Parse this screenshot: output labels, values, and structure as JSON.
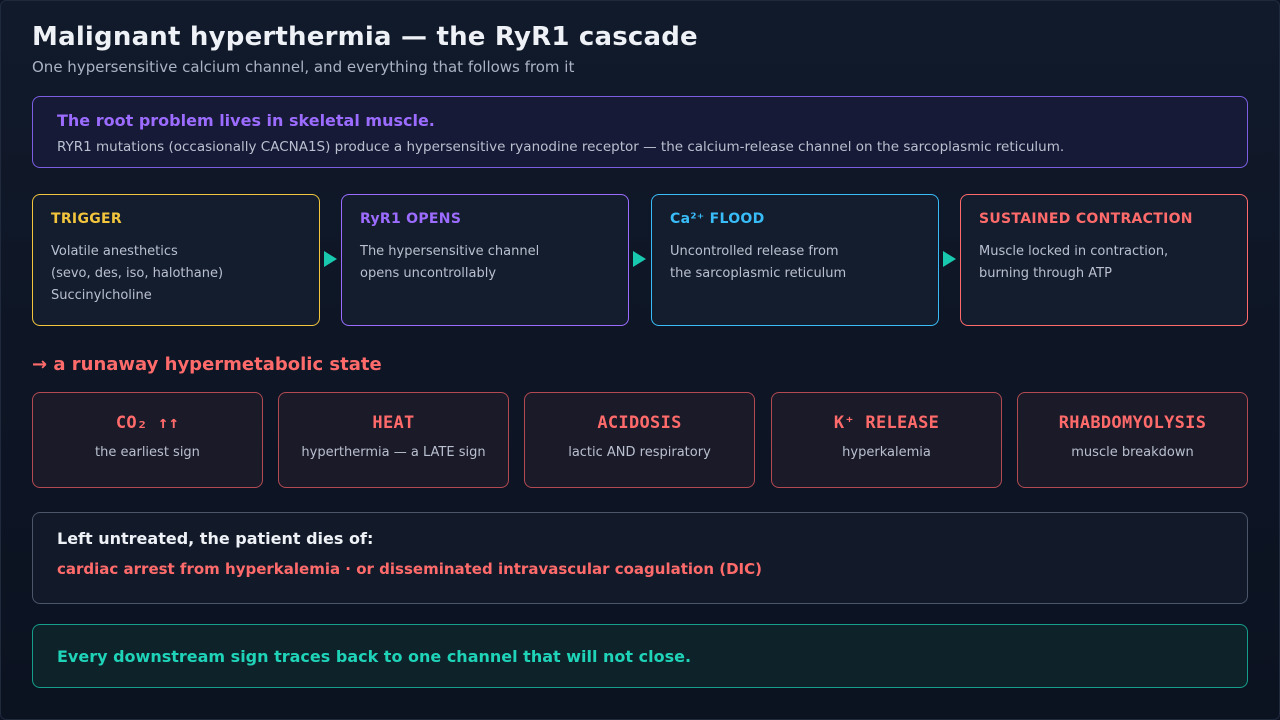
{
  "header": {
    "title": "Malignant hyperthermia — the RyR1 cascade",
    "subtitle": "One hypersensitive calcium channel, and everything that follows from it"
  },
  "root": {
    "heading": "The root problem lives in skeletal muscle.",
    "text": "RYR1 mutations (occasionally CACNA1S) produce a hypersensitive ryanodine receptor — the calcium-release channel on the sarcoplasmic reticulum."
  },
  "cascade": [
    {
      "label": "TRIGGER",
      "body": "Volatile anesthetics\n(sevo, des, iso, halothane)\nSuccinylcholine",
      "color": "#f2c53d"
    },
    {
      "label": "RyR1 OPENS",
      "body": "The hypersensitive channel\nopens uncontrollably",
      "color": "#9b6cff"
    },
    {
      "label": "Ca²⁺ FLOOD",
      "body": "Uncontrolled release from\nthe sarcoplasmic reticulum",
      "color": "#38bdf8"
    },
    {
      "label": "SUSTAINED CONTRACTION",
      "body": "Muscle locked in contraction,\nburning through ATP",
      "color": "#ff6b6b"
    }
  ],
  "arrow_color": "#18c9b0",
  "state": {
    "heading": "→ a runaway hypermetabolic state"
  },
  "effects": [
    {
      "name": "CO₂ ↑↑",
      "desc": "the earliest sign"
    },
    {
      "name": "HEAT",
      "desc": "hyperthermia — a LATE sign"
    },
    {
      "name": "ACIDOSIS",
      "desc": "lactic AND respiratory"
    },
    {
      "name": "K⁺ RELEASE",
      "desc": "hyperkalemia"
    },
    {
      "name": "RHABDOMYOLYSIS",
      "desc": "muscle breakdown"
    }
  ],
  "outcome": {
    "heading": "Left untreated, the patient dies of:",
    "text": "cardiac arrest from hyperkalemia · or disseminated intravascular coagulation (DIC)"
  },
  "conclusion": {
    "text": "Every downstream sign traces back to one channel that will not close."
  }
}
